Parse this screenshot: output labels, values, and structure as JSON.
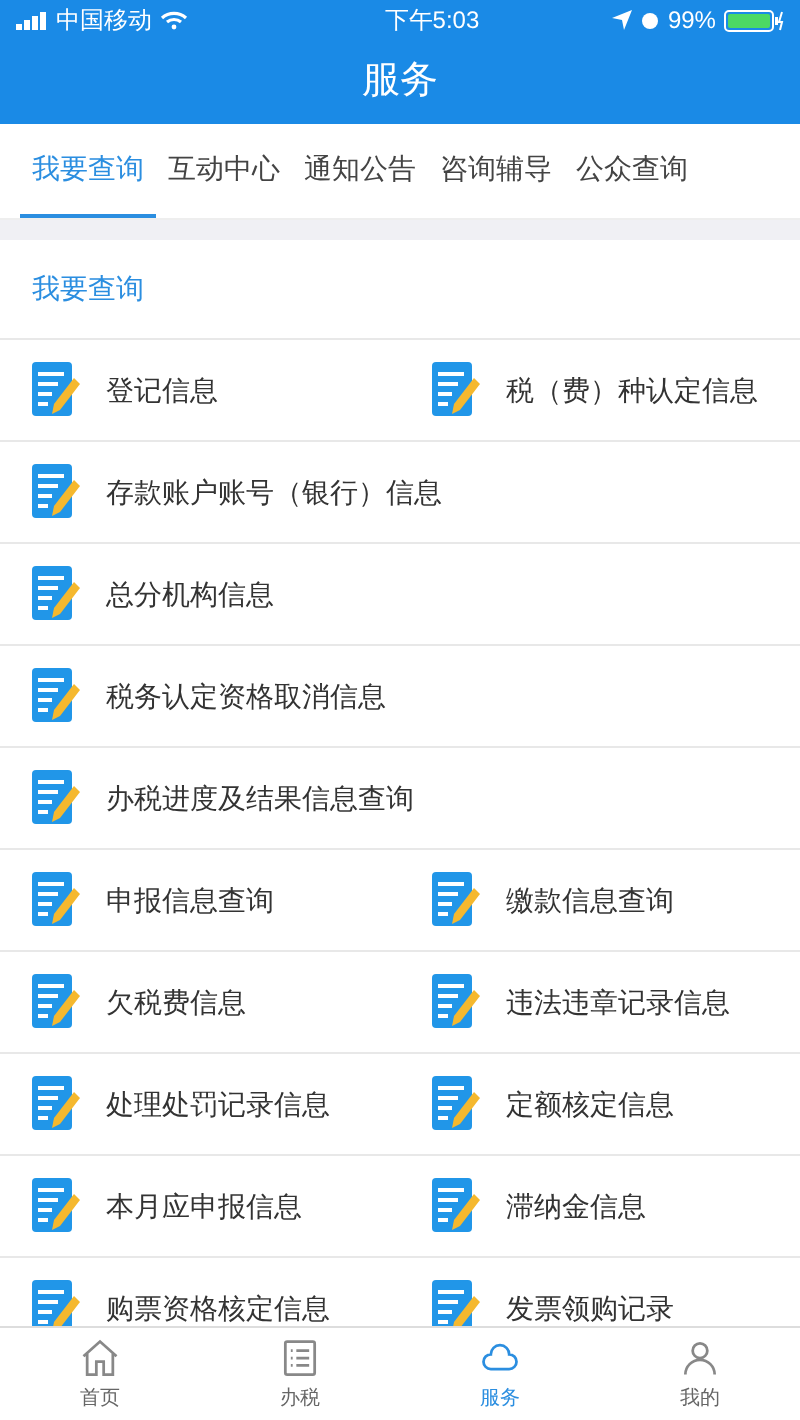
{
  "status_bar": {
    "carrier": "中国移动",
    "time": "下午5:03",
    "battery": "99%"
  },
  "header": {
    "title": "服务"
  },
  "tabs": [
    {
      "label": "我要查询",
      "selected": true
    },
    {
      "label": "互动中心",
      "selected": false
    },
    {
      "label": "通知公告",
      "selected": false
    },
    {
      "label": "咨询辅导",
      "selected": false
    },
    {
      "label": "公众查询",
      "selected": false
    }
  ],
  "section": {
    "title": "我要查询"
  },
  "rows": [
    {
      "items": [
        "登记信息",
        "税（费）种认定信息"
      ]
    },
    {
      "items": [
        "存款账户账号（银行）信息"
      ]
    },
    {
      "items": [
        "总分机构信息"
      ]
    },
    {
      "items": [
        "税务认定资格取消信息"
      ]
    },
    {
      "items": [
        "办税进度及结果信息查询"
      ]
    },
    {
      "items": [
        "申报信息查询",
        "缴款信息查询"
      ]
    },
    {
      "items": [
        "欠税费信息",
        "违法违章记录信息"
      ]
    },
    {
      "items": [
        "处理处罚记录信息",
        "定额核定信息"
      ]
    },
    {
      "items": [
        "本月应申报信息",
        "滞纳金信息"
      ]
    },
    {
      "items": [
        "购票资格核定信息",
        "发票领购记录"
      ]
    }
  ],
  "bottom_nav": [
    {
      "label": "首页",
      "kind": "home",
      "selected": false
    },
    {
      "label": "办税",
      "kind": "list",
      "selected": false
    },
    {
      "label": "服务",
      "kind": "service",
      "selected": true
    },
    {
      "label": "我的",
      "kind": "user",
      "selected": false
    }
  ]
}
